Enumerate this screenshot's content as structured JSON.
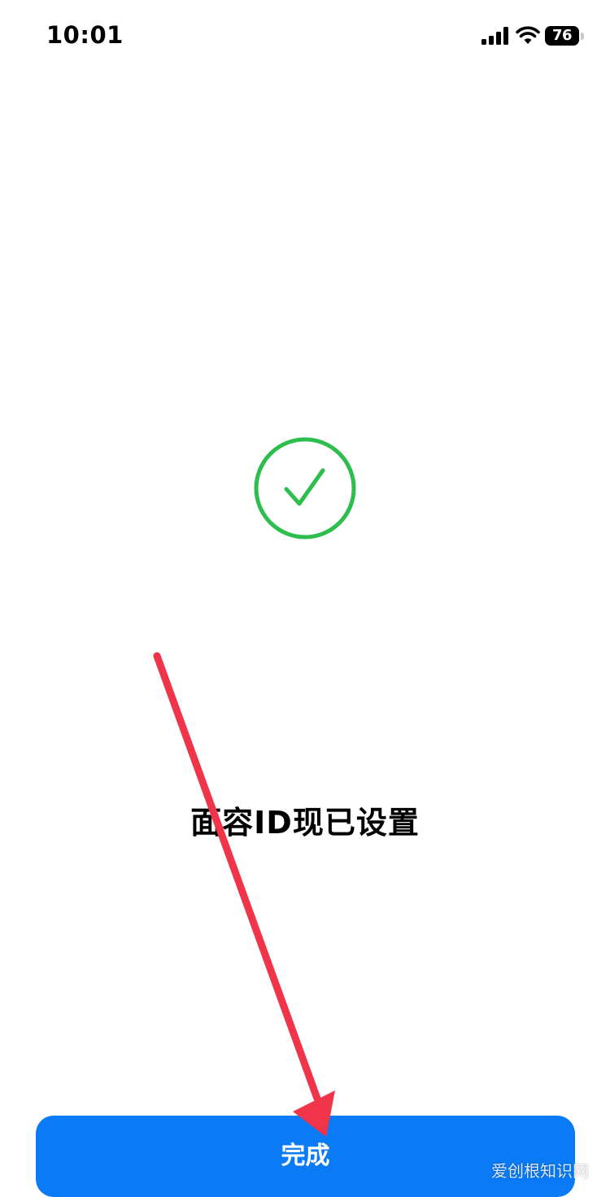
{
  "status_bar": {
    "time": "10:01",
    "battery_level": "76",
    "icons": [
      "signal-icon",
      "wifi-icon",
      "battery-icon"
    ]
  },
  "main": {
    "success_icon": "checkmark-circle-icon",
    "headline": "面容ID现已设置"
  },
  "footer": {
    "done_label": "完成"
  },
  "watermark": "爱创根知识网",
  "colors": {
    "accent": "#0A7AF5",
    "success": "#2DBE4E",
    "annotation_arrow": "#F0344A"
  }
}
